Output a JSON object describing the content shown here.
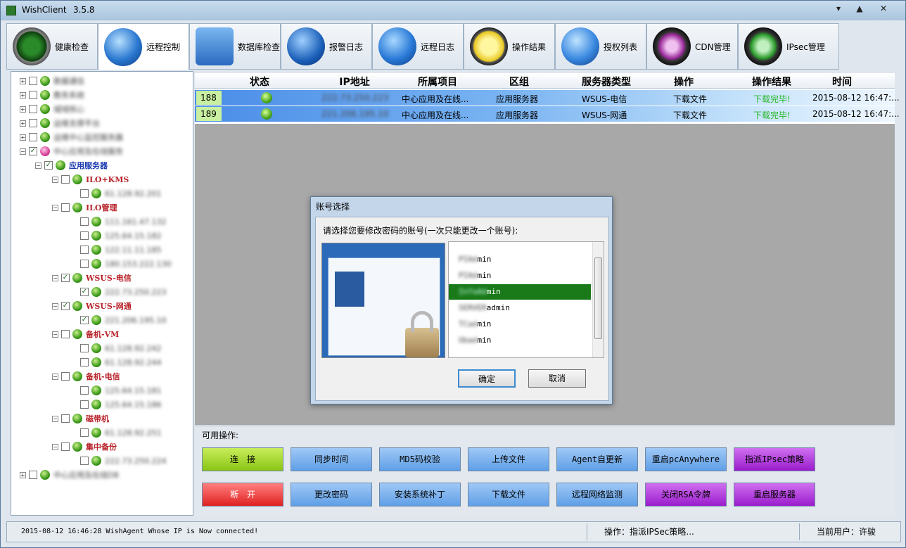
{
  "window": {
    "title": "WishClient",
    "version": "3.5.8",
    "controls": [
      "▾",
      "▲",
      "✕"
    ]
  },
  "toolbar": {
    "tabs": [
      {
        "label": "健康检查",
        "icon": "radar-icon"
      },
      {
        "label": "远程控制",
        "icon": "globe-icon",
        "active": true
      },
      {
        "label": "数据库检查",
        "icon": "database-monitor-icon"
      },
      {
        "label": "报警日志",
        "icon": "megaphone-icon"
      },
      {
        "label": "远程日志",
        "icon": "globe-wrench-icon"
      },
      {
        "label": "操作结果",
        "icon": "clock-icon"
      },
      {
        "label": "授权列表",
        "icon": "globe-shield-icon"
      },
      {
        "label": "CDN管理",
        "icon": "yinyang-purple-icon"
      },
      {
        "label": "IPsec管理",
        "icon": "yinyang-green-icon"
      }
    ]
  },
  "tree": {
    "groups": [
      {
        "label": "应用服务器"
      },
      {
        "label": "ILO+KMS"
      },
      {
        "label": "ILO管理"
      },
      {
        "label": "WSUS-电信"
      },
      {
        "label": "WSUS-网通"
      },
      {
        "label": "备机-VM"
      },
      {
        "label": "备机-电信"
      },
      {
        "label": "磁带机"
      },
      {
        "label": "集中备份"
      }
    ]
  },
  "table": {
    "headers": [
      "状态",
      "IP地址",
      "所属项目",
      "区组",
      "服务器类型",
      "操作",
      "操作结果",
      "时间"
    ],
    "rows": [
      {
        "num": "188",
        "project": "中心应用及在线...",
        "zone": "应用服务器",
        "type": "WSUS-电信",
        "op": "下载文件",
        "result": "下载完毕!",
        "time": "2015-08-12 16:47:..."
      },
      {
        "num": "189",
        "project": "中心应用及在线...",
        "zone": "应用服务器",
        "type": "WSUS-网通",
        "op": "下载文件",
        "result": "下载完毕!",
        "time": "2015-08-12 16:47:..."
      }
    ]
  },
  "ops": {
    "title": "可用操作:",
    "row1": [
      "连　接",
      "同步时间",
      "MD5码校验",
      "上传文件",
      "Agent自更新",
      "重启pcAnywhere",
      "指派IPsec策略"
    ],
    "row2": [
      "断　开",
      "更改密码",
      "安装系统补丁",
      "下载文件",
      "远程网络监测",
      "关闭RSA令牌",
      "重启服务器"
    ]
  },
  "status": {
    "log": "2015-08-12 16:46:28  WishAgent Whose IP is                 Now connected!",
    "op": "操作：指派IPSec策略...",
    "user": "当前用户：许骏"
  },
  "dialog": {
    "title": "账号选择",
    "prompt": "请选择您要修改密码的账号(一次只能更改一个账号):",
    "accounts": [
      "min",
      "min",
      "min",
      "admin",
      "min",
      "min"
    ],
    "ok": "确定",
    "cancel": "取消"
  }
}
